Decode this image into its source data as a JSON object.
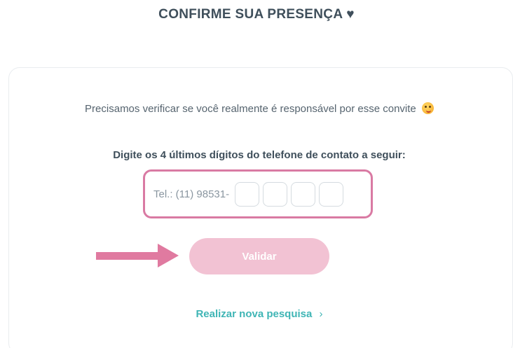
{
  "header": {
    "title": "CONFIRME SUA PRESENÇA ♥"
  },
  "verification": {
    "intro_text": "Precisamos verificar se você realmente é responsável por esse convite",
    "instruction": "Digite os 4 últimos dígitos do telefone de contato a seguir:",
    "phone_prefix": "Tel.: (11) 98531-",
    "digits": [
      "",
      "",
      "",
      ""
    ]
  },
  "actions": {
    "validate_label": "Validar",
    "new_search_label": "Realizar nova pesquisa",
    "new_search_chevron": "›"
  },
  "colors": {
    "highlight_border": "#d97aa3",
    "validate_button": "#f2c2d3",
    "link": "#3fb5b5",
    "arrow": "#e07aa0"
  }
}
